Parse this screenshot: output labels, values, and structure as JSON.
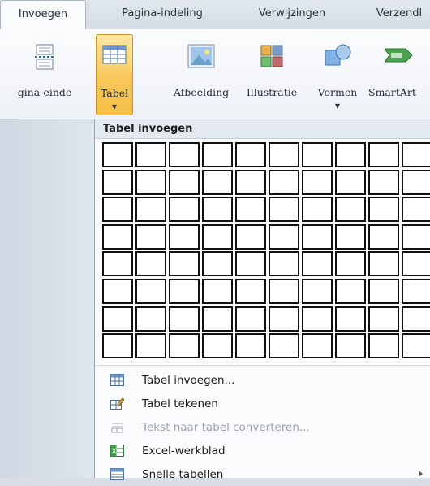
{
  "tabs": [
    "Invoegen",
    "Pagina-indeling",
    "Verwijzingen",
    "Verzendl"
  ],
  "ribbon": {
    "page_break": "gina-einde",
    "table": "Tabel",
    "picture": "Afbeelding",
    "clipart": "Illustratie",
    "shapes": "Vormen",
    "smartart": "SmartArt"
  },
  "menu": {
    "header": "Tabel invoegen",
    "grid": {
      "columns": 10,
      "rows": 8
    },
    "items": [
      {
        "label": "Tabel invoegen...",
        "enabled": true
      },
      {
        "label": "Tabel tekenen",
        "enabled": true
      },
      {
        "label": "Tekst naar tabel converteren...",
        "enabled": false
      },
      {
        "label": "Excel-werkblad",
        "enabled": true
      },
      {
        "label": "Snelle tabellen",
        "enabled": true
      }
    ]
  },
  "colors": {
    "pressed": "#f8c85a",
    "accent": "#3a6ea5"
  }
}
